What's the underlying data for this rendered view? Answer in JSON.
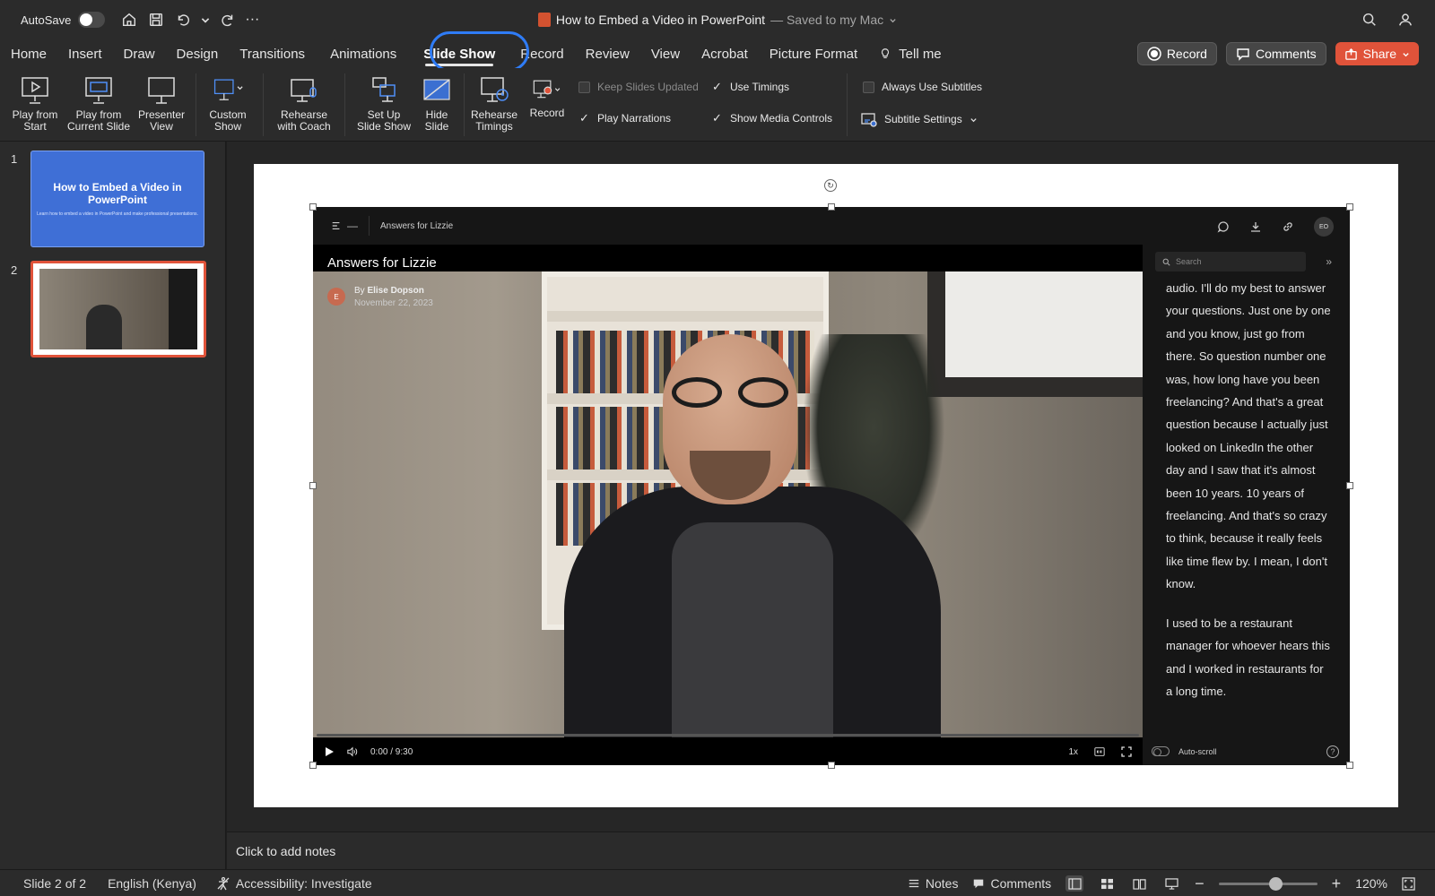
{
  "titlebar": {
    "autosave_label": "AutoSave",
    "doc_title": "How to Embed a Video in PowerPoint",
    "saved_status": "— Saved to my Mac",
    "more": "···"
  },
  "tabs": [
    {
      "label": "Home"
    },
    {
      "label": "Insert"
    },
    {
      "label": "Draw"
    },
    {
      "label": "Design"
    },
    {
      "label": "Transitions"
    },
    {
      "label": "Animations"
    },
    {
      "label": "Slide Show"
    },
    {
      "label": "Record"
    },
    {
      "label": "Review"
    },
    {
      "label": "View"
    },
    {
      "label": "Acrobat"
    },
    {
      "label": "Picture Format"
    },
    {
      "label": "Tell me"
    }
  ],
  "active_tab": "Slide Show",
  "top_buttons": {
    "record": "Record",
    "comments": "Comments",
    "share": "Share"
  },
  "ribbon": {
    "play_from_start": [
      "Play from",
      "Start"
    ],
    "play_from_current": [
      "Play from",
      "Current Slide"
    ],
    "presenter_view": [
      "Presenter",
      "View"
    ],
    "custom_show": [
      "Custom",
      "Show"
    ],
    "rehearse_coach": [
      "Rehearse",
      "with Coach"
    ],
    "setup_show": [
      "Set Up",
      "Slide Show"
    ],
    "hide_slide": [
      "Hide",
      "Slide"
    ],
    "rehearse_timings": [
      "Rehearse",
      "Timings"
    ],
    "record": "Record",
    "keep_updated": "Keep Slides Updated",
    "play_narrations": "Play Narrations",
    "use_timings": "Use Timings",
    "show_media_controls": "Show Media Controls",
    "always_subtitles": "Always Use Subtitles",
    "subtitle_settings": "Subtitle Settings"
  },
  "thumbnails": {
    "slide1_num": "1",
    "slide2_num": "2",
    "slide1_title": "How to Embed a Video in PowerPoint",
    "slide1_sub": "Learn how to embed a video in PowerPoint and make professional presentations."
  },
  "video": {
    "app_name": "Answers for Lizzie",
    "heading": "Answers for Lizzie",
    "author_prefix": "By",
    "author": "Elise Dopson",
    "author_initial": "E",
    "date": "November 22, 2023",
    "user_initials": "EO",
    "time": "0:00 / 9:30",
    "speed": "1x",
    "search_placeholder": "Search",
    "transcript_p1": "audio. I'll do my best to answer your questions. Just one by one and you know, just go from there. So question number one was, how long have you been freelancing? And that's a great question because I actually just looked on LinkedIn the other day and I saw that it's almost been 10 years. 10 years of freelancing. And that's so crazy to think, because it really feels like time flew by. I mean, I don't know.",
    "transcript_p2": "I used to be a restaurant manager for whoever hears this and I worked in restaurants for a long time.",
    "autoscroll": "Auto-scroll",
    "help": "?",
    "progress": 0
  },
  "notes_placeholder": "Click to add notes",
  "status": {
    "slide_of": "Slide 2 of 2",
    "language": "English (Kenya)",
    "accessibility": "Accessibility: Investigate",
    "notes": "Notes",
    "comments": "Comments",
    "zoom": "120%"
  },
  "colors": {
    "accent_ring": "#2f7cf6",
    "share": "#e0533a",
    "slide1_bg": "#3f6fd6"
  }
}
